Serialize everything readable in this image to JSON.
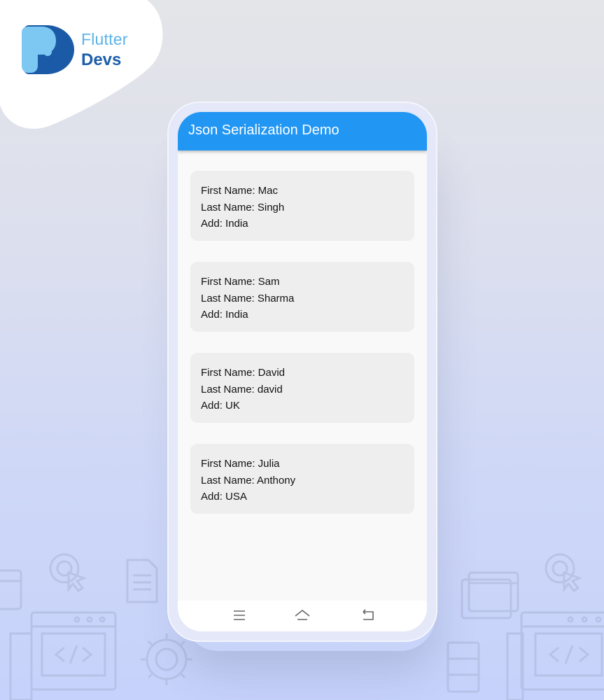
{
  "brand": {
    "line1": "Flutter",
    "line2": "Devs"
  },
  "app_bar": {
    "title": "Json Serialization Demo"
  },
  "people": [
    {
      "first": "First Name: Mac",
      "last": "Last Name: Singh",
      "add": "Add: India"
    },
    {
      "first": "First Name: Sam",
      "last": "Last Name: Sharma",
      "add": "Add: India"
    },
    {
      "first": "First Name: David",
      "last": "Last Name: david",
      "add": "Add: UK"
    },
    {
      "first": "First Name: Julia",
      "last": "Last Name: Anthony",
      "add": "Add: USA"
    }
  ],
  "nav_bar": {
    "icons": [
      "menu-icon",
      "home-icon",
      "back-icon"
    ]
  },
  "colors": {
    "app_bar": "#2196f3",
    "card": "#eeeeee",
    "brand_light": "#5bb3e8",
    "brand_dark": "#1c5ea8"
  }
}
